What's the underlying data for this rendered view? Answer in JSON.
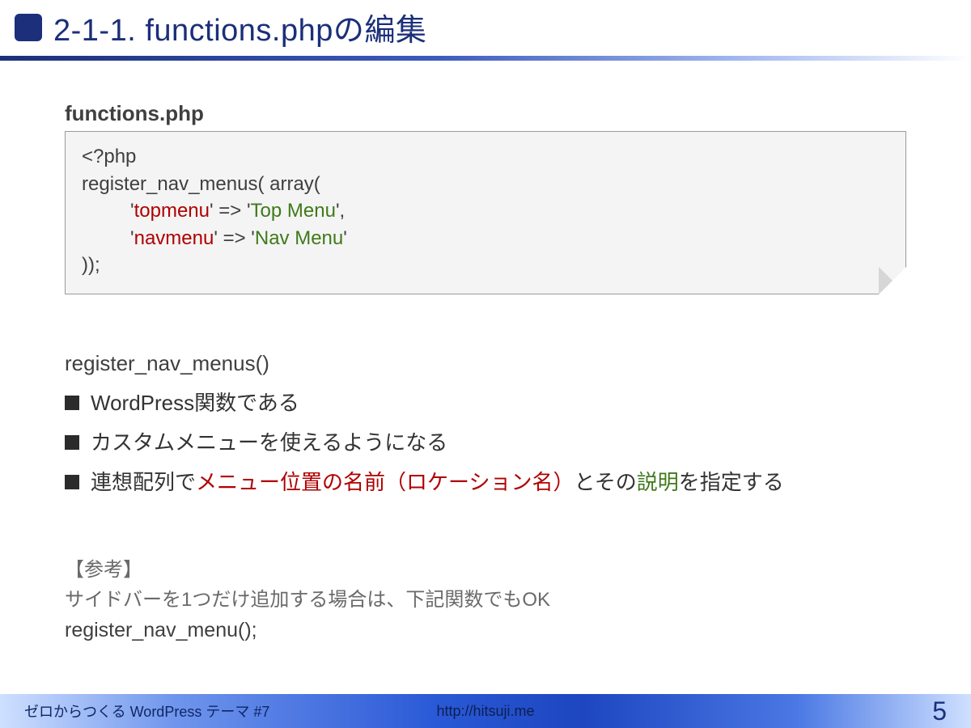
{
  "header": {
    "title": "2-1-1. functions.phpの編集"
  },
  "file": {
    "label": "functions.php"
  },
  "code": {
    "l1": "<?php",
    "l2": "register_nav_menus( array(",
    "l3a": "'",
    "l3key": "topmenu",
    "l3b": "' => '",
    "l3val": "Top Menu",
    "l3c": "',",
    "l4a": "'",
    "l4key": "navmenu",
    "l4b": "' => '",
    "l4val": "Nav Menu",
    "l4c": "'",
    "l5": "));"
  },
  "section": {
    "heading": "register_nav_menus()"
  },
  "bullets": {
    "b1": "WordPress関数である",
    "b2": "カスタムメニューを使えるようになる",
    "b3_pre": "連想配列で",
    "b3_red": "メニュー位置の名前（ロケーション名）",
    "b3_mid": "とその",
    "b3_green": "説明",
    "b3_post": "を指定する"
  },
  "ref": {
    "label": "【参考】",
    "text": "サイドバーを1つだけ追加する場合は、下記関数でもOK",
    "func": "register_nav_menu();"
  },
  "footer": {
    "left": "ゼロからつくる WordPress テーマ #7",
    "center": "http://hitsuji.me",
    "page": "5"
  }
}
